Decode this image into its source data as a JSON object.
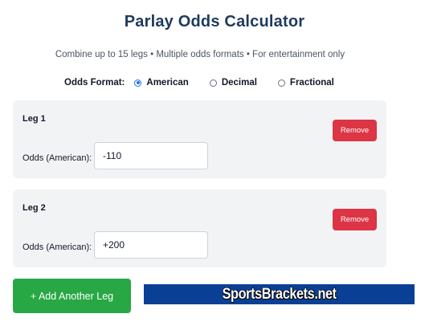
{
  "header": {
    "title": "Parlay Odds Calculator",
    "subtitle": "Combine up to 15 legs • Multiple odds formats • For entertainment only"
  },
  "odds_format": {
    "label": "Odds Format:",
    "options": [
      {
        "label": "American",
        "selected": true
      },
      {
        "label": "Decimal",
        "selected": false
      },
      {
        "label": "Fractional",
        "selected": false
      }
    ]
  },
  "legs": [
    {
      "title": "Leg 1",
      "remove_label": "Remove",
      "odds_label": "Odds (American):",
      "odds_value": "-110"
    },
    {
      "title": "Leg 2",
      "remove_label": "Remove",
      "odds_label": "Odds (American):",
      "odds_value": "+200"
    }
  ],
  "actions": {
    "add_leg_label": "+ Add Another Leg"
  },
  "banner": {
    "text": "SportsBrackets.net"
  },
  "colors": {
    "title": "#1e3a5f",
    "remove_button": "#dc3545",
    "add_button": "#28a745",
    "banner_bg": "#0a3f96",
    "radio_accent": "#1d6fe8"
  }
}
